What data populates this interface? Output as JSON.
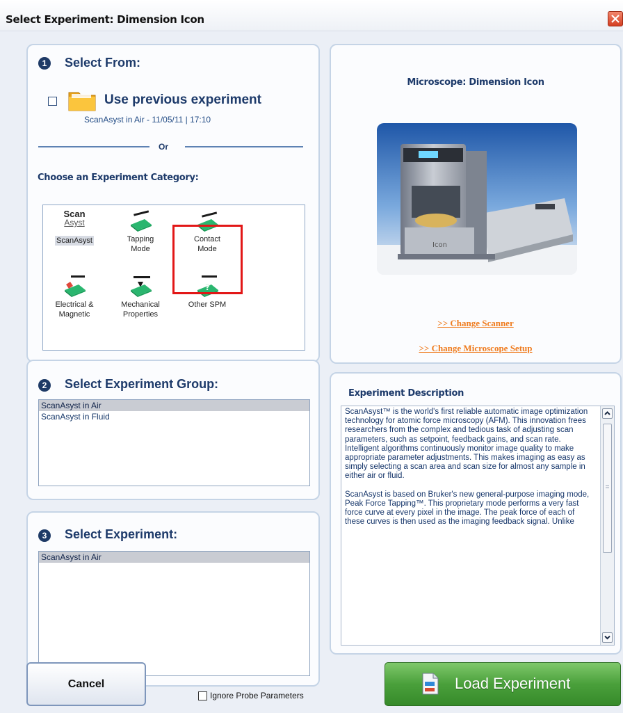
{
  "window": {
    "title": "Select Experiment: Dimension Icon"
  },
  "step1": {
    "badge": "1",
    "title": "Select From:",
    "use_previous_label": "Use previous experiment",
    "previous_experiment": "ScanAsyst in Air - 11/05/11 | 17:10",
    "or_text": "Or",
    "category_heading": "Choose an Experiment Category:",
    "categories": [
      {
        "label_1": "ScanAsyst",
        "label_2": "",
        "icon": "scanasyst-logo-icon",
        "logo_1": "Scan",
        "logo_2": "Asyst",
        "selected": true
      },
      {
        "label_1": "Tapping",
        "label_2": "Mode",
        "icon": "tapping-mode-icon",
        "selected": false
      },
      {
        "label_1": "Contact",
        "label_2": "Mode",
        "icon": "contact-mode-icon",
        "selected": false,
        "highlighted": true
      },
      {
        "label_1": "Electrical &",
        "label_2": "Magnetic",
        "icon": "electrical-magnetic-icon",
        "selected": false
      },
      {
        "label_1": "Mechanical",
        "label_2": "Properties",
        "icon": "mechanical-properties-icon",
        "selected": false
      },
      {
        "label_1": "Other SPM",
        "label_2": "",
        "icon": "other-spm-icon",
        "selected": false
      }
    ]
  },
  "step2": {
    "badge": "2",
    "title": "Select Experiment Group:",
    "items": [
      "ScanAsyst in Air",
      "ScanAsyst in Fluid"
    ],
    "selected_index": 0
  },
  "step3": {
    "badge": "3",
    "title": "Select Experiment:",
    "items": [
      "ScanAsyst in Air"
    ],
    "selected_index": 0
  },
  "microscope": {
    "title": "Microscope: Dimension Icon",
    "image_icon": "microscope-photo",
    "change_scanner": ">> Change Scanner",
    "change_setup": ">> Change Microscope Setup"
  },
  "description": {
    "title": "Experiment Description",
    "paragraph_1": "ScanAsyst™ is the world's first reliable automatic image optimization technology for atomic force microscopy (AFM). This innovation frees researchers from the complex and tedious task of adjusting scan parameters, such as setpoint, feedback gains, and scan rate. Intelligent algorithms continuously monitor image quality to make appropriate parameter adjustments. This makes imaging as easy as simply selecting a scan area and scan size for almost any sample in either air or fluid.",
    "paragraph_2": "ScanAsyst is based on Bruker's new general-purpose imaging mode, Peak Force Tapping™. This proprietary mode performs a very fast force curve at every pixel in the image. The peak force of each of these curves is then used as the imaging feedback signal. Unlike"
  },
  "footer": {
    "cancel_label": "Cancel",
    "ignore_probe_label": "Ignore Probe Parameters",
    "load_label": "Load Experiment"
  },
  "colors": {
    "accent_blue": "#1d3a6a",
    "link_orange": "#ef7c1f",
    "load_green": "#4aa03b",
    "highlight_red": "#e21717"
  }
}
